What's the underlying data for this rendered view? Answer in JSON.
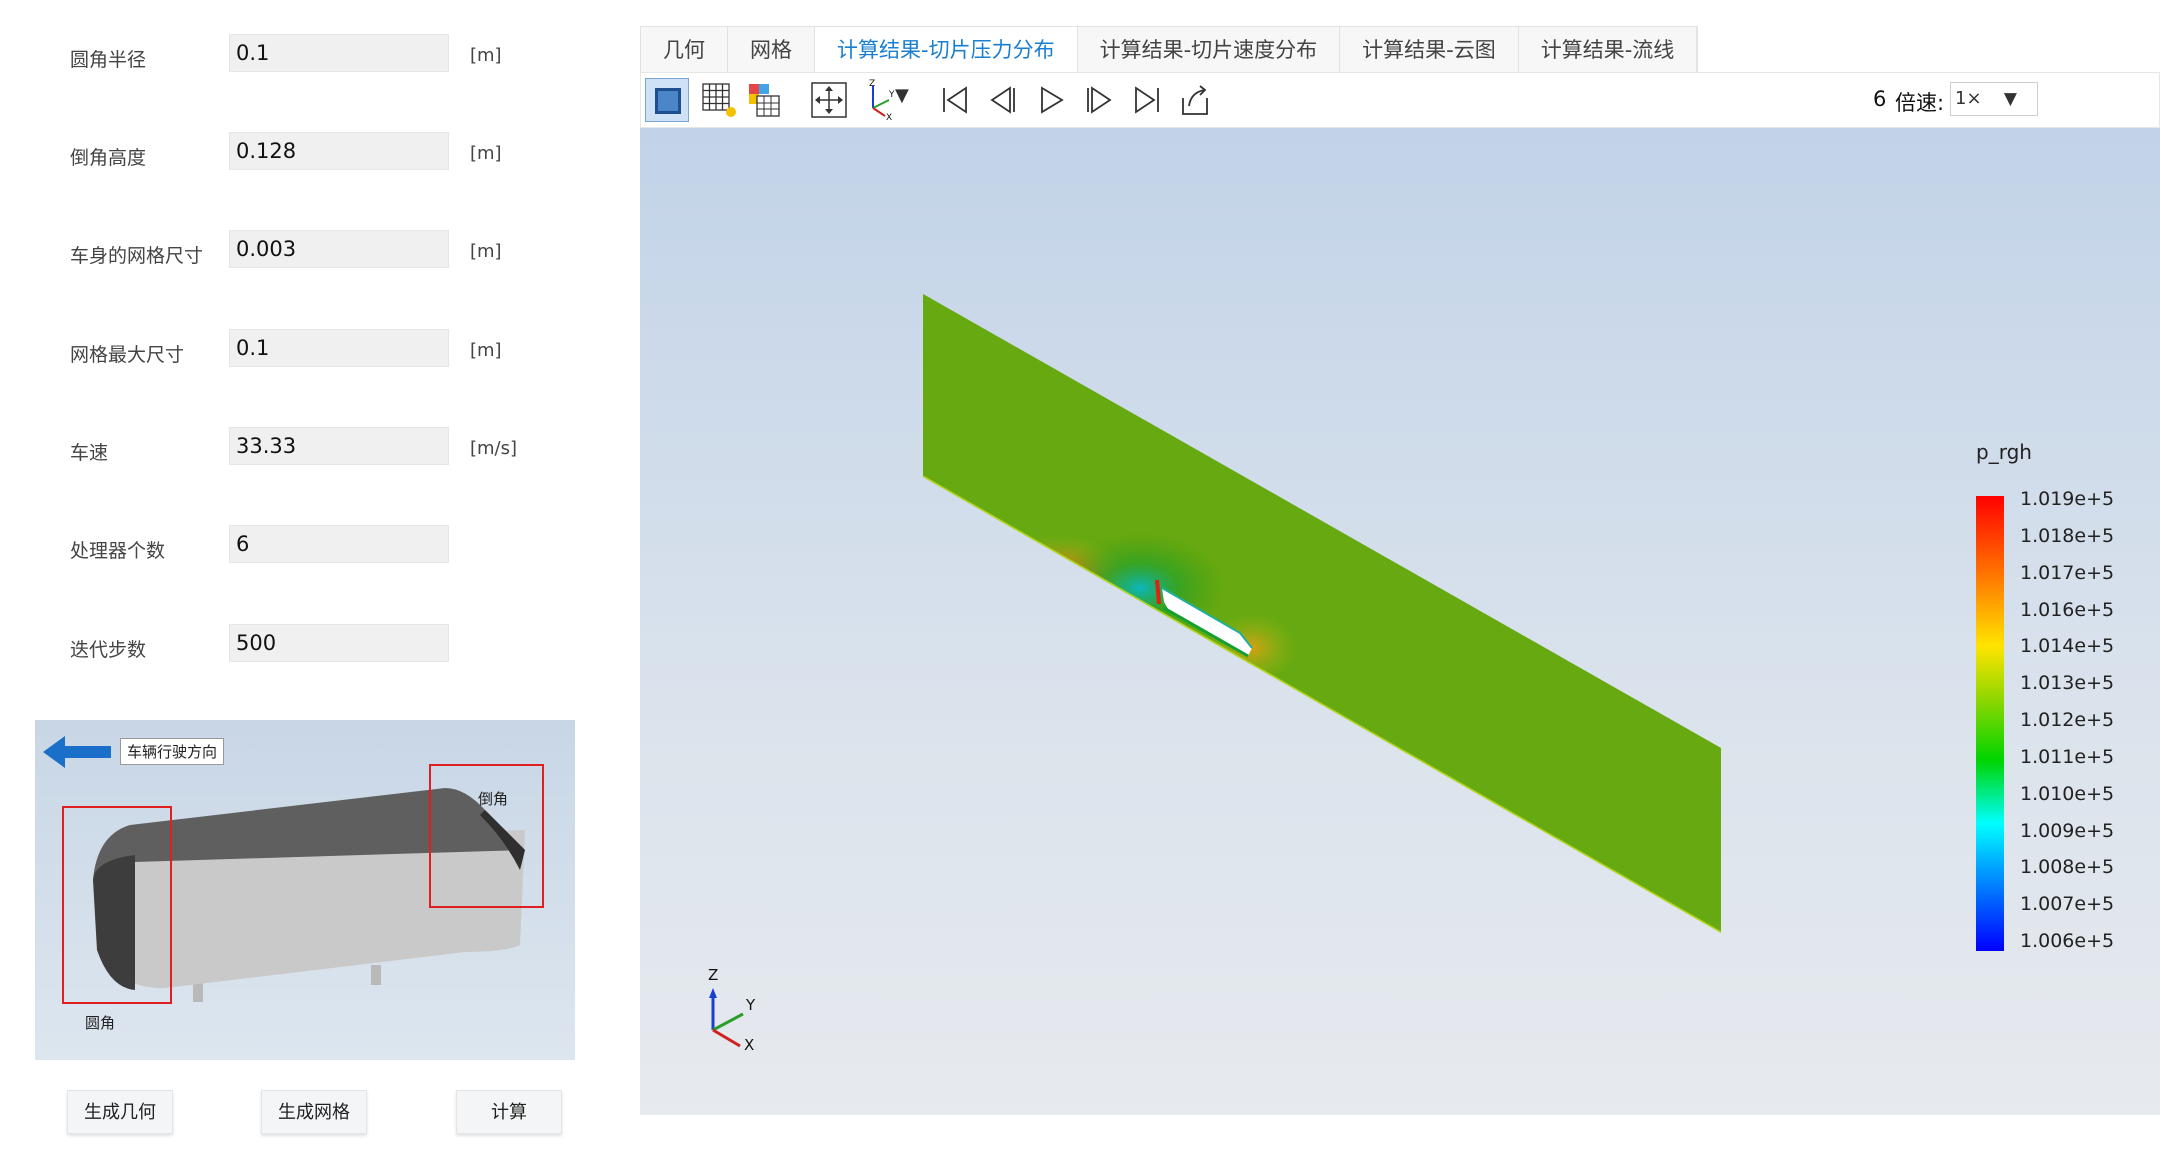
{
  "params": [
    {
      "label": "圆角半径",
      "value": "0.1",
      "unit": "[m]"
    },
    {
      "label": "倒角高度",
      "value": "0.128",
      "unit": "[m]"
    },
    {
      "label": "车身的网格尺寸",
      "value": "0.003",
      "unit": "[m]"
    },
    {
      "label": "网格最大尺寸",
      "value": "0.1",
      "unit": "[m]"
    },
    {
      "label": "车速",
      "value": "33.33",
      "unit": "[m/s]"
    },
    {
      "label": "处理器个数",
      "value": "6",
      "unit": ""
    },
    {
      "label": "迭代步数",
      "value": "500",
      "unit": ""
    }
  ],
  "preview": {
    "direction_label": "车辆行驶方向",
    "chamfer_label": "倒角",
    "fillet_label": "圆角"
  },
  "buttons": {
    "generate_geometry": "生成几何",
    "generate_mesh": "生成网格",
    "compute": "计算"
  },
  "tabs": [
    {
      "label": "几何",
      "active": false
    },
    {
      "label": "网格",
      "active": false
    },
    {
      "label": "计算结果-切片压力分布",
      "active": true
    },
    {
      "label": "计算结果-切片速度分布",
      "active": false
    },
    {
      "label": "计算结果-云图",
      "active": false
    },
    {
      "label": "计算结果-流线",
      "active": false
    }
  ],
  "toolbar": {
    "icons": [
      "surface-view-icon",
      "mesh-view-icon",
      "lighting-icon",
      "fit-view-icon",
      "axes-orientation-icon",
      "first-frame-icon",
      "previous-frame-icon",
      "play-icon",
      "next-frame-icon",
      "last-frame-icon",
      "export-icon"
    ],
    "frame_count": "6",
    "speed_label": "倍速:",
    "speed_value": "1×",
    "dropdown_arrow": "▼"
  },
  "legend": {
    "title": "p_rgh",
    "ticks": [
      "1.019e+5",
      "1.018e+5",
      "1.017e+5",
      "1.016e+5",
      "1.014e+5",
      "1.013e+5",
      "1.012e+5",
      "1.011e+5",
      "1.010e+5",
      "1.009e+5",
      "1.008e+5",
      "1.007e+5",
      "1.006e+5"
    ],
    "colors": {
      "max": "#ff0000",
      "mid": "#00d400",
      "min": "#0000ff",
      "slice": "#5a9e0c"
    }
  },
  "axes": {
    "z": "Z",
    "y": "Y",
    "x": "X"
  }
}
